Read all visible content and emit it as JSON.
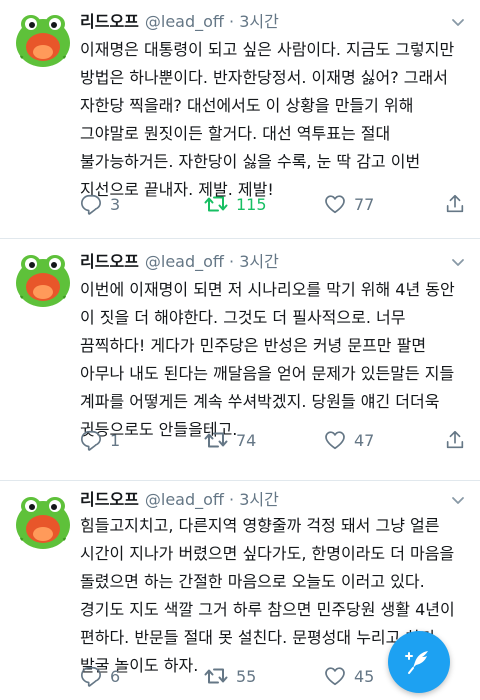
{
  "tweets": [
    {
      "name": "리드오프",
      "handle": "@lead_off",
      "separator": "·",
      "time": "3시간",
      "text": "이재명은 대통령이 되고 싶은 사람이다. 지금도 그렇지만 방법은 하나뿐이다. 반자한당정서. 이재명 싫어? 그래서 자한당 찍을래? 대선에서도 이 상황을 만들기 위해 그야말로 뭔짓이든 할거다. 대선 역투표는 절대 불가능하거든. 자한당이 싫을 수록, 눈 딱 감고 이번 지선으로 끝내자. 제발. 제발!",
      "replies": "3",
      "retweets": "115",
      "likes": "77",
      "retweeted": true
    },
    {
      "name": "리드오프",
      "handle": "@lead_off",
      "separator": "·",
      "time": "3시간",
      "text": "이번에 이재명이 되면 저 시나리오를 막기 위해 4년 동안 이 짓을 더 해야한다. 그것도 더 필사적으로. 너무 끔찍하다! 게다가 민주당은 반성은 커녕 문프만 팔면 아무나 내도 된다는 깨달음을 얻어 문제가 있든말든 지들 계파를 어떻게든 계속 쑤셔박겠지. 당원들 얘긴 더더욱 귓등으로도 안들을테고.",
      "replies": "1",
      "retweets": "74",
      "likes": "47",
      "retweeted": false
    },
    {
      "name": "리드오프",
      "handle": "@lead_off",
      "separator": "·",
      "time": "3시간",
      "text": "힘들고지치고, 다른지역 영향줄까 걱정 돼서 그냥 얼른 시간이 지나가 버렸으면 싶다가도, 한명이라도 더 마음을 돌렸으면 하는 간절한 마음으로 오늘도 이러고 있다. 경기도 지도 색깔 그거 하루 참으면 민주당원 생활 4년이 편하다. 반문들 절대 못 설친다. 문평성대 누리고 차기 발굴 놀이도 하자.",
      "replies": "6",
      "retweets": "55",
      "likes": "45",
      "retweeted": false
    }
  ],
  "icons": {
    "reply": "reply-icon",
    "retweet": "retweet-icon",
    "like": "heart-icon",
    "share": "share-icon",
    "compose": "compose-feather-icon",
    "menu": "chevron-down-icon"
  },
  "colors": {
    "accent": "#1da1f2",
    "retweet_active": "#17bf63",
    "muted": "#657786",
    "avatar_bg": "#5ec13a"
  }
}
